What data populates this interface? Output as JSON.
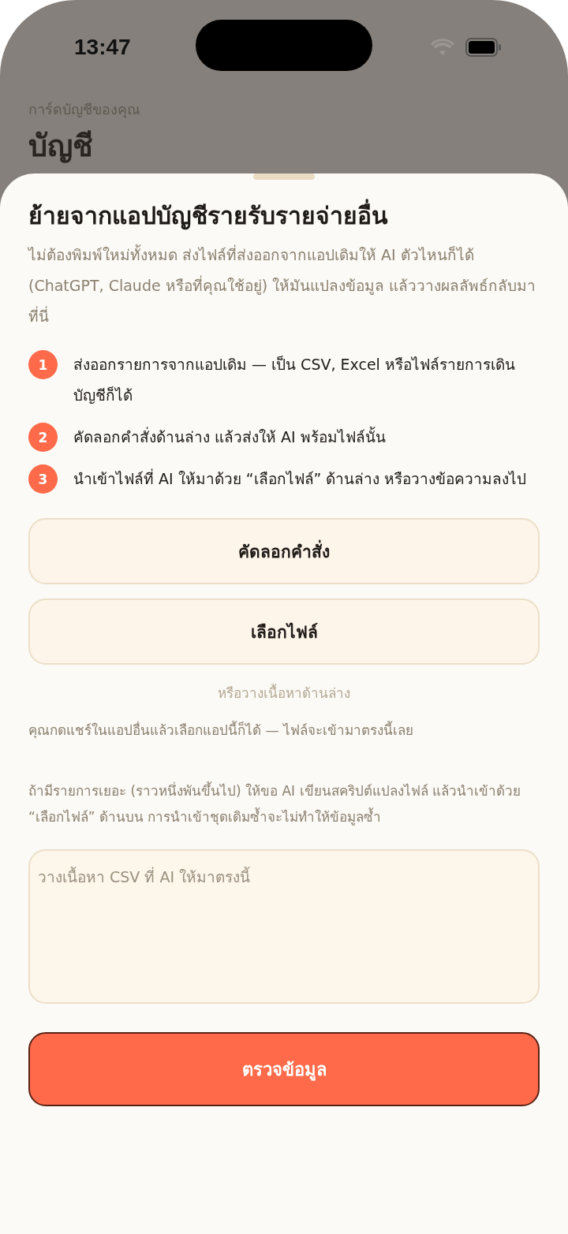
{
  "status_bar": {
    "time": "13:47"
  },
  "background": {
    "subtitle": "การ์ดบัญชีของคุณ",
    "title": "บัญชี"
  },
  "sheet": {
    "title": "ย้ายจากแอปบัญชีรายรับรายจ่ายอื่น",
    "intro": "ไม่ต้องพิมพ์ใหม่ทั้งหมด ส่งไฟล์ที่ส่งออกจากแอปเดิมให้ AI ตัวไหนก็ได้ (ChatGPT, Claude หรือที่คุณใช้อยู่) ให้มันแปลงข้อมูล แล้ววางผลลัพธ์กลับมาที่นี่",
    "steps": [
      {
        "number": "1",
        "text": "ส่งออกรายการจากแอปเดิม — เป็น CSV, Excel หรือไฟล์รายการเดินบัญชีก็ได้"
      },
      {
        "number": "2",
        "text": "คัดลอกคำสั่งด้านล่าง แล้วส่งให้ AI พร้อมไฟล์นั้น"
      },
      {
        "number": "3",
        "text": "นำเข้าไฟล์ที่ AI ให้มาด้วย “เลือกไฟล์” ด้านล่าง หรือวางข้อความลงไป"
      }
    ],
    "buttons": [
      "คัดลอกคำสั่ง",
      "เลือกไฟล์"
    ],
    "hint": "หรือวางเนื้อหาด้านล่าง",
    "share_note": "คุณกดแชร์ในแอปอื่นแล้วเลือกแอปนี้ก็ได้ — ไฟล์จะเข้ามาตรงนี้เลย",
    "bulk_note": "ถ้ามีรายการเยอะ (ราวหนึ่งพันขึ้นไป) ให้ขอ AI เขียนสคริปต์แปลงไฟล์ แล้วนำเข้าด้วย “เลือกไฟล์” ด้านบน การนำเข้าชุดเดิมซ้ำจะไม่ทำให้ข้อมูลซ้ำ",
    "paste_field": {
      "placeholder": "วางเนื้อหา CSV ที่ AI ให้มาตรงนี้"
    },
    "primary_button": "ตรวจข้อมูล"
  }
}
